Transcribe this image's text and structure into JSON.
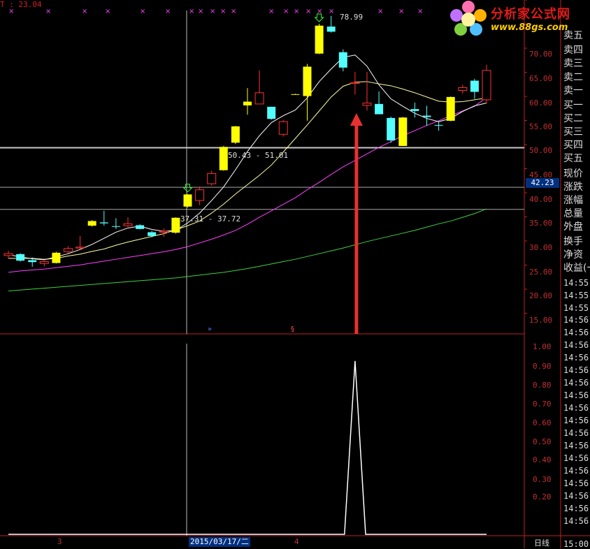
{
  "header": {
    "top_value": "T : 23.04"
  },
  "logo": {
    "title": "分析家公式网",
    "url": "www.88gs.com"
  },
  "price_axis": {
    "labels": [
      "70.00",
      "65.00",
      "60.00",
      "55.00",
      "50.00",
      "45.00",
      "40.00",
      "35.00",
      "30.00",
      "25.00",
      "20.00",
      "15.00"
    ],
    "current": "42.23"
  },
  "indicator_axis": {
    "labels": [
      "1.00",
      "0.90",
      "0.80",
      "0.70",
      "0.60",
      "0.50",
      "0.40",
      "0.30",
      "0.20"
    ]
  },
  "side_panel": {
    "items": [
      "卖五",
      "卖四",
      "卖三",
      "卖二",
      "卖一",
      "买一",
      "买二",
      "买三",
      "买四",
      "买五",
      "现价",
      "涨跌",
      "涨幅",
      "总量",
      "外盘",
      "换手",
      "净资",
      "收益(一"
    ],
    "times": [
      "14:55",
      "14:55",
      "14:55",
      "14:56",
      "14:56",
      "14:56",
      "14:56",
      "14:56",
      "14:56",
      "14:56",
      "14:56",
      "14:56",
      "14:56",
      "14:56",
      "14:56",
      "14:56",
      "14:56",
      "14:56",
      "14:56",
      "14:56",
      "15:00"
    ]
  },
  "annotations": {
    "peak": "78.99",
    "range_high": "50.43 - 51.01",
    "range_low": "37.31 - 37.72"
  },
  "x_axis": {
    "label_3": "3",
    "cursor_date": "2015/03/17/二",
    "label_4": "4",
    "period": "日线"
  },
  "colors": {
    "up_yellow": "#ffff00",
    "down_cyan": "#54ffff",
    "up_hollow_red": "#ff3030",
    "ma_white": "#ffffff",
    "ma_yellow": "#ffffa0",
    "ma_magenta": "#ff40ff",
    "ma_green": "#40d040",
    "arrow_red": "#e83030",
    "signal_white": "#ffffff"
  },
  "chart_data": {
    "type": "candlestick",
    "ylim": [
      12,
      80
    ],
    "candles": [
      {
        "o": 27.6,
        "h": 28.6,
        "l": 26.9,
        "c": 28.0,
        "t": "r"
      },
      {
        "o": 27.9,
        "h": 28.1,
        "l": 26.3,
        "c": 26.5,
        "t": "c"
      },
      {
        "o": 26.6,
        "h": 27.2,
        "l": 25.2,
        "c": 26.2,
        "t": "c"
      },
      {
        "o": 25.9,
        "h": 26.5,
        "l": 25.3,
        "c": 26.3,
        "t": "r"
      },
      {
        "o": 26.0,
        "h": 28.4,
        "l": 25.9,
        "c": 28.2,
        "t": "y"
      },
      {
        "o": 28.4,
        "h": 29.6,
        "l": 28.1,
        "c": 29.1,
        "t": "r"
      },
      {
        "o": 29.2,
        "h": 31.8,
        "l": 28.9,
        "c": 29.4,
        "t": "r"
      },
      {
        "o": 34.0,
        "h": 35.2,
        "l": 33.8,
        "c": 35.0,
        "t": "y"
      },
      {
        "o": 34.7,
        "h": 37.2,
        "l": 34.0,
        "c": 34.5,
        "t": "c"
      },
      {
        "o": 33.8,
        "h": 35.6,
        "l": 33.3,
        "c": 33.9,
        "t": "c"
      },
      {
        "o": 34.0,
        "h": 35.8,
        "l": 33.3,
        "c": 34.4,
        "t": "r"
      },
      {
        "o": 34.1,
        "h": 34.3,
        "l": 33.2,
        "c": 33.3,
        "t": "c"
      },
      {
        "o": 32.6,
        "h": 32.9,
        "l": 31.5,
        "c": 31.8,
        "t": "c"
      },
      {
        "o": 32.6,
        "h": 33.4,
        "l": 31.6,
        "c": 32.8,
        "t": "r"
      },
      {
        "o": 32.5,
        "h": 35.8,
        "l": 32.3,
        "c": 35.7,
        "t": "y"
      },
      {
        "o": 38.1,
        "h": 40.8,
        "l": 37.9,
        "c": 40.7,
        "t": "y"
      },
      {
        "o": 39.4,
        "h": 42.4,
        "l": 38.4,
        "c": 41.7,
        "t": "r"
      },
      {
        "o": 43.0,
        "h": 45.8,
        "l": 42.6,
        "c": 45.2,
        "t": "r"
      },
      {
        "o": 45.9,
        "h": 51.1,
        "l": 45.8,
        "c": 50.9,
        "t": "y"
      },
      {
        "o": 51.8,
        "h": 55.4,
        "l": 51.5,
        "c": 55.3,
        "t": "y"
      },
      {
        "o": 59.8,
        "h": 63.5,
        "l": 57.8,
        "c": 60.6,
        "t": "y"
      },
      {
        "o": 60.1,
        "h": 67.3,
        "l": 60.1,
        "c": 62.5,
        "t": "r"
      },
      {
        "o": 59.5,
        "h": 59.5,
        "l": 56.7,
        "c": 56.9,
        "t": "c"
      },
      {
        "o": 53.6,
        "h": 56.7,
        "l": 53.1,
        "c": 56.3,
        "t": "r"
      },
      {
        "o": 62.2,
        "h": 62.3,
        "l": 62.1,
        "c": 62.1,
        "t": "y"
      },
      {
        "o": 61.8,
        "h": 68.7,
        "l": 56.5,
        "c": 68.1,
        "t": "y"
      },
      {
        "o": 70.9,
        "h": 77.3,
        "l": 70.8,
        "c": 76.9,
        "t": "y"
      },
      {
        "o": 76.7,
        "h": 78.99,
        "l": 75.4,
        "c": 75.6,
        "t": "c"
      },
      {
        "o": 71.2,
        "h": 71.8,
        "l": 67.1,
        "c": 67.9,
        "t": "c"
      },
      {
        "o": 64.7,
        "h": 67.0,
        "l": 62.1,
        "c": 64.5,
        "t": "r"
      },
      {
        "o": 59.8,
        "h": 67.0,
        "l": 58.7,
        "c": 60.3,
        "t": "r"
      },
      {
        "o": 60.1,
        "h": 62.8,
        "l": 57.9,
        "c": 57.9,
        "t": "c"
      },
      {
        "o": 57.1,
        "h": 57.4,
        "l": 51.8,
        "c": 52.3,
        "t": "c"
      },
      {
        "o": 51.1,
        "h": 57.3,
        "l": 51.1,
        "c": 57.2,
        "t": "y"
      },
      {
        "o": 59.0,
        "h": 60.4,
        "l": 57.2,
        "c": 58.6,
        "t": "c"
      },
      {
        "o": 57.6,
        "h": 59.7,
        "l": 55.4,
        "c": 57.3,
        "t": "c"
      },
      {
        "o": 55.6,
        "h": 56.3,
        "l": 54.4,
        "c": 55.5,
        "t": "c"
      },
      {
        "o": 56.5,
        "h": 61.7,
        "l": 56.4,
        "c": 61.6,
        "t": "y"
      },
      {
        "o": 63.6,
        "h": 64.2,
        "l": 62.3,
        "c": 63.0,
        "t": "r"
      },
      {
        "o": 65.1,
        "h": 65.5,
        "l": 61.2,
        "c": 62.7,
        "t": "c"
      },
      {
        "o": 61.0,
        "h": 68.5,
        "l": 60.2,
        "c": 67.3,
        "t": "r"
      }
    ],
    "ma5": [
      27.8,
      27.3,
      26.9,
      26.7,
      27.3,
      28.0,
      28.9,
      30.0,
      31.3,
      32.6,
      33.5,
      33.9,
      33.2,
      32.8,
      33.0,
      34.6,
      36.7,
      39.4,
      42.3,
      46.0,
      49.9,
      53.3,
      56.1,
      57.6,
      58.8,
      61.4,
      64.9,
      67.6,
      70.1,
      70.6,
      68.2,
      64.2,
      61.2,
      59.6,
      58.1,
      57.0,
      56.3,
      57.0,
      58.5,
      59.7,
      60.3
    ],
    "ma10": [
      27.0,
      27.0,
      27.0,
      26.8,
      27.0,
      27.5,
      27.9,
      28.5,
      29.0,
      29.8,
      30.5,
      31.1,
      31.7,
      32.3,
      33.1,
      34.0,
      35.0,
      36.7,
      38.6,
      40.8,
      42.8,
      44.8,
      47.0,
      49.8,
      52.7,
      55.6,
      58.6,
      61.6,
      63.9,
      64.8,
      64.9,
      64.4,
      64.0,
      63.3,
      62.5,
      61.6,
      60.7,
      60.5,
      60.6,
      61.0,
      61.4
    ],
    "ma30": [
      24.0,
      24.3,
      24.5,
      24.7,
      25.0,
      25.3,
      25.6,
      26.0,
      26.4,
      26.8,
      27.2,
      27.6,
      28.0,
      28.4,
      28.9,
      29.5,
      30.3,
      31.1,
      32.0,
      33.0,
      34.3,
      35.8,
      37.2,
      38.6,
      40.0,
      41.7,
      43.3,
      45.0,
      46.6,
      48.0,
      49.4,
      50.8,
      52.0,
      53.3,
      54.4,
      55.5,
      56.5,
      57.6,
      58.6,
      59.6,
      61.5
    ],
    "ma60": [
      20.0,
      20.2,
      20.4,
      20.6,
      20.8,
      21.0,
      21.2,
      21.4,
      21.6,
      21.8,
      22.0,
      22.2,
      22.4,
      22.6,
      22.8,
      23.1,
      23.4,
      23.7,
      24.0,
      24.4,
      24.8,
      25.3,
      25.8,
      26.3,
      26.8,
      27.4,
      28.0,
      28.6,
      29.2,
      29.9,
      30.6,
      31.2,
      31.8,
      32.4,
      33.0,
      33.7,
      34.4,
      35.0,
      35.8,
      36.6,
      37.6
    ],
    "signal": [
      0,
      0,
      0,
      0,
      0,
      0,
      0,
      0,
      0,
      0,
      0,
      0,
      0,
      0,
      0,
      0,
      0,
      0,
      0,
      0,
      0,
      0,
      0,
      0,
      0,
      0,
      0,
      0,
      0,
      1,
      0,
      0,
      0,
      0,
      0,
      0,
      0,
      0,
      0,
      0,
      0
    ],
    "signal_ylim": [
      0,
      1.08
    ],
    "reference_lines": [
      50.72,
      42.23,
      37.5
    ],
    "down_arrows": [
      15,
      26
    ]
  }
}
